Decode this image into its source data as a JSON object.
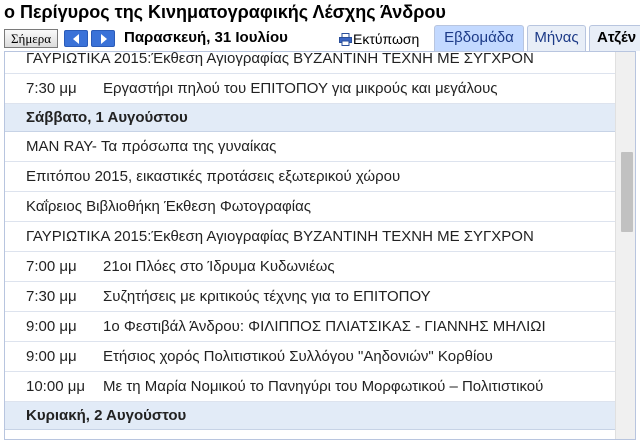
{
  "calendar_title": "ο Περίγυρος της Κινηματογραφικής Λέσχης Άνδρου",
  "toolbar": {
    "today_label": "Σήμερα",
    "current_date": "Παρασκευή, 31 Ιουλίου",
    "print_label": "Εκτύπωση"
  },
  "tabs": {
    "week": "Εβδομάδα",
    "month": "Μήνας",
    "agenda": "Ατζέν"
  },
  "agenda": {
    "prev_day_events": [
      {
        "time": "",
        "title": "ΓΑΥΡΙΩΤΙΚΑ 2015:Έκθεση Αγιογραφίας ΒΥΖΑΝΤΙΝΗ ΤΕΧΝΗ ΜΕ ΣΥΓΧΡΟΝ"
      },
      {
        "time": "7:30 μμ",
        "title": "Εργαστήρι πηλού του ΕΠΙΤΟΠΟΥ για μικρούς και μεγάλους"
      }
    ],
    "saturday_header": "Σάββατο, 1 Αυγούστου",
    "saturday_events": [
      {
        "time": "",
        "title": "MAN RAY- Τα πρόσωπα της γυναίκας"
      },
      {
        "time": "",
        "title": "Επιτόπου 2015, εικαστικές προτάσεις εξωτερικού χώρου"
      },
      {
        "time": "",
        "title": "Καΐρειος Βιβλιοθήκη Έκθεση Φωτογραφίας"
      },
      {
        "time": "",
        "title": "ΓΑΥΡΙΩΤΙΚΑ 2015:Έκθεση Αγιογραφίας ΒΥΖΑΝΤΙΝΗ ΤΕΧΝΗ ΜΕ ΣΥΓΧΡΟΝ"
      },
      {
        "time": "7:00 μμ",
        "title": "21οι Πλόες στο Ίδρυμα Κυδωνιέως"
      },
      {
        "time": "7:30 μμ",
        "title": "Συζητήσεις με κριτικούς τέχνης για το ΕΠΙΤΟΠΟΥ"
      },
      {
        "time": "9:00 μμ",
        "title": "1ο Φεστιβάλ Άνδρου: ΦΙΛΙΠΠΟΣ ΠΛΙΑΤΣΙΚΑΣ - ΓΙΑΝΝΗΣ ΜΗΛΙΩΙ"
      },
      {
        "time": "9:00 μμ",
        "title": "Ετήσιος χορός Πολιτιστικού Συλλόγου \"Αηδονιών\" Κορθίου"
      },
      {
        "time": "10:00 μμ",
        "title": "Με τη Μαρία Νομικού το Πανηγύρι του Μορφωτικού – Πολιτιστικού"
      }
    ],
    "sunday_header": "Κυριακή, 2 Αυγούστου"
  },
  "colors": {
    "day_header_bg": "#e2ebf7",
    "selected_tab_bg": "#c3d9ff",
    "nav_button_bg": "#3a72d8"
  }
}
